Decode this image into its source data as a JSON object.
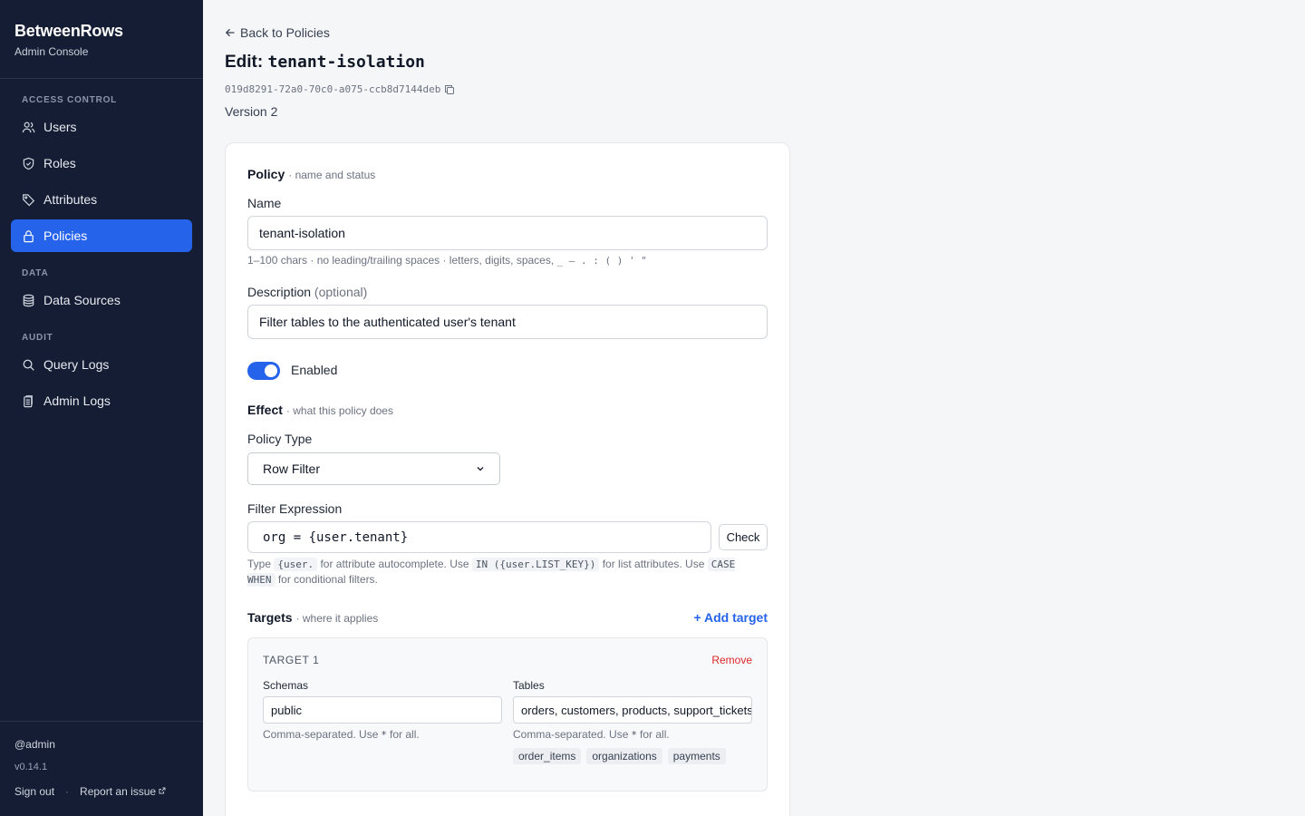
{
  "sidebar": {
    "brand": "BetweenRows",
    "subtitle": "Admin Console",
    "sections": {
      "access": "ACCESS CONTROL",
      "data": "DATA",
      "audit": "AUDIT"
    },
    "items": [
      {
        "label": "Users",
        "icon": "users-icon"
      },
      {
        "label": "Roles",
        "icon": "shield-icon"
      },
      {
        "label": "Attributes",
        "icon": "tag-icon"
      },
      {
        "label": "Policies",
        "icon": "lock-icon",
        "active": true
      },
      {
        "label": "Data Sources",
        "icon": "database-icon"
      },
      {
        "label": "Query Logs",
        "icon": "search-icon"
      },
      {
        "label": "Admin Logs",
        "icon": "clipboard-icon"
      }
    ],
    "user": "@admin",
    "version": "v0.14.1",
    "sign_out": "Sign out",
    "separator": "·",
    "report": "Report an issue"
  },
  "header": {
    "back": "Back to Policies",
    "title_prefix": "Edit:",
    "title_name": "tenant-isolation",
    "policy_id": "019d8291-72a0-70c0-a075-ccb8d7144deb",
    "version": "Version 2"
  },
  "form": {
    "policy_section": {
      "title": "Policy",
      "sub": "· name and status"
    },
    "name_label": "Name",
    "name_value": "tenant-isolation",
    "name_hint": "1–100 chars · no leading/trailing spaces · letters, digits, spaces,",
    "name_hint_chars": "_ – . : ( ) ' \"",
    "description_label": "Description",
    "description_optional": "(optional)",
    "description_value": "Filter tables to the authenticated user's tenant",
    "enabled_label": "Enabled",
    "enabled": true,
    "effect_section": {
      "title": "Effect",
      "sub": "· what this policy does"
    },
    "policy_type_label": "Policy Type",
    "policy_type_value": "Row Filter",
    "filter_label": "Filter Expression",
    "filter_value": "org = {user.tenant}",
    "check_button": "Check",
    "filter_hint": {
      "t1": "Type",
      "c1": "{user.",
      "t2": "for attribute autocomplete. Use",
      "c2": "IN ({user.LIST_KEY})",
      "t3": "for list attributes. Use",
      "c3": "CASE WHEN",
      "t4": "for conditional filters."
    },
    "targets_section": {
      "title": "Targets",
      "sub": "· where it applies"
    },
    "add_target": "+ Add target",
    "target": {
      "title": "TARGET 1",
      "remove": "Remove",
      "schemas_label": "Schemas",
      "schemas_value": "public",
      "tables_label": "Tables",
      "tables_value": "orders, customers, products, support_tickets",
      "hint_prefix": "Comma-separated. Use",
      "hint_code": "*",
      "hint_suffix": "for all.",
      "table_chips": [
        "order_items",
        "organizations",
        "payments"
      ]
    }
  },
  "colors": {
    "sidebar_bg": "#141d33",
    "accent": "#2563eb",
    "danger": "#dc2626"
  }
}
